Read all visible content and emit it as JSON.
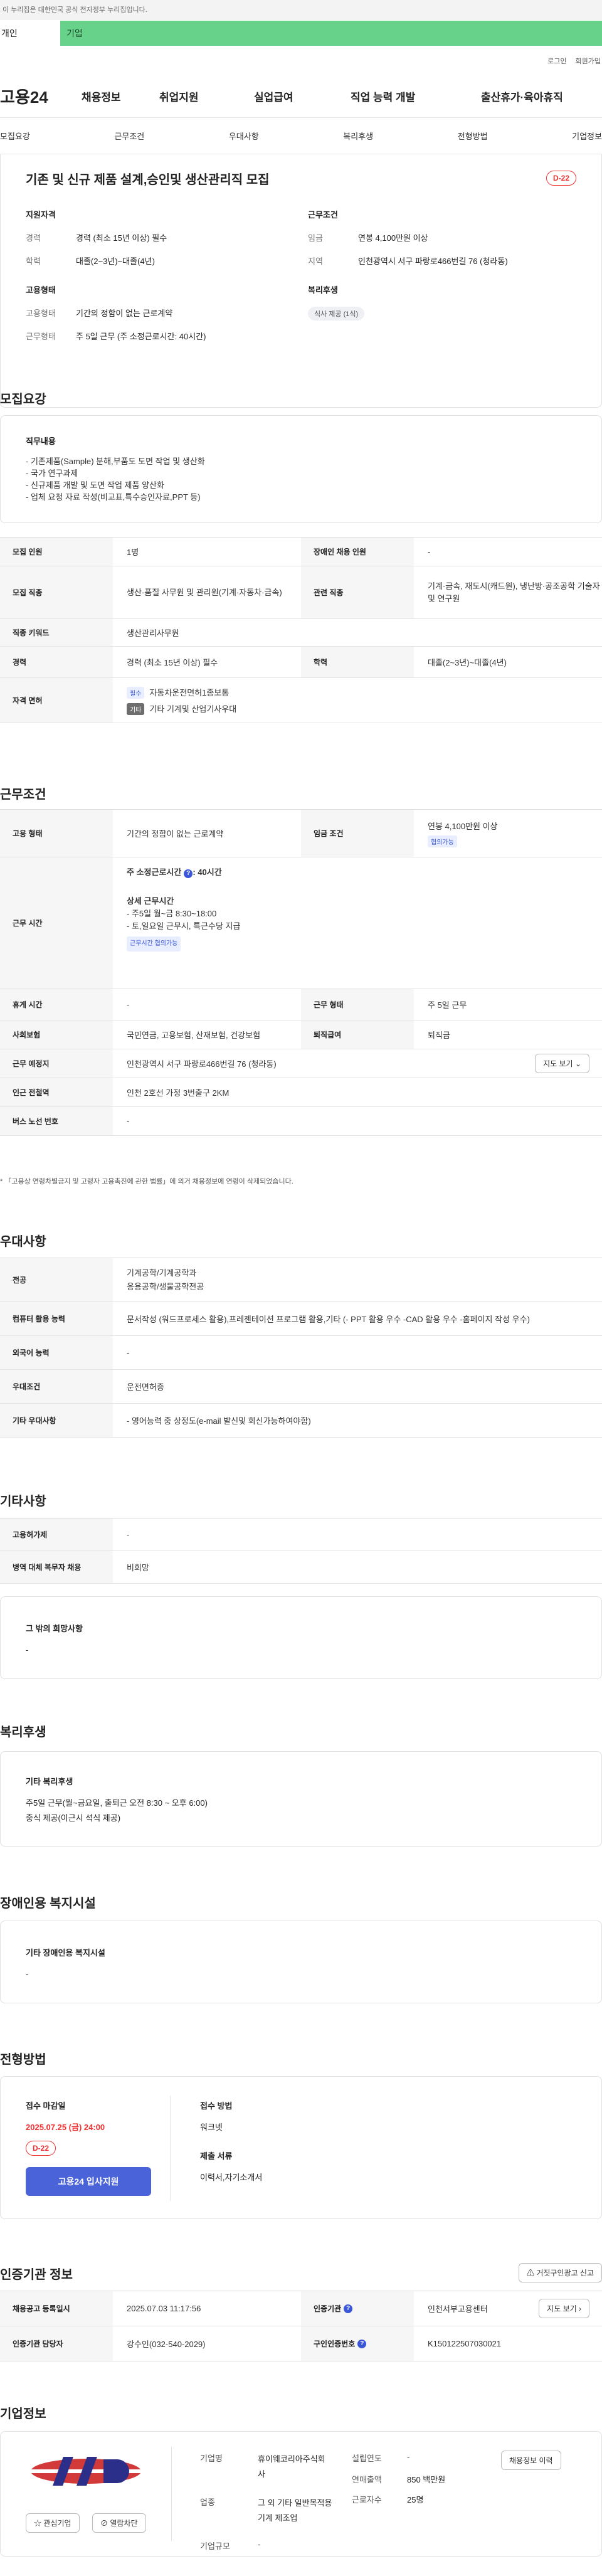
{
  "header": {
    "gov_banner": "이 누리집은 대한민국 공식 전자정부 누리집입니다.",
    "tab_personal": "개인",
    "tab_corporate": "기업",
    "login": "로그인",
    "join": "회원가입",
    "logo": "고용24",
    "gnb": [
      "채용정보",
      "취업지원",
      "실업급여",
      "직업 능력 개발",
      "출산휴가·육아휴직"
    ]
  },
  "subnav": [
    "모집요강",
    "근무조건",
    "우대사항",
    "복리후생",
    "전형방법",
    "기업정보"
  ],
  "summary": {
    "title": "기존 및 신규 제품 설계,승인및 생산관리직 모집",
    "dday": "D-22",
    "qual_heading": "지원자격",
    "qual_items": [
      {
        "k": "경력",
        "v": "경력 (최소 15년 이상) 필수"
      },
      {
        "k": "학력",
        "v": "대졸(2~3년)~대졸(4년)"
      }
    ],
    "cond_heading": "근무조건",
    "cond_items": [
      {
        "k": "임금",
        "v": "연봉 4,100만원 이상"
      },
      {
        "k": "지역",
        "v": "인천광역시 서구 파랑로466번길 76 (청라동)"
      }
    ],
    "emp_heading": "고용형태",
    "emp_items": [
      {
        "k": "고용형태",
        "v": "기간의 정함이 없는 근로계약"
      },
      {
        "k": "근무형태",
        "v": "주 5일 근무 (주 소정근로시간: 40시간)"
      }
    ],
    "welfare_heading": "복리후생",
    "welfare_chip": "식사 제공 (1식)"
  },
  "recruit": {
    "title": "모집요강",
    "duty_heading": "직무내용",
    "duty_lines": [
      "- 기존제품(Sample) 분해,부품도 도면 작업 및 생산화",
      "- 국가 연구과제",
      "- 신규제품 개발 및 도면 작업 제품 양산화",
      "- 업체 요청 자료 작성(비교표,특수승인자료,PPT 등)"
    ],
    "rows": {
      "headcount_label": "모집 인원",
      "headcount": "1명",
      "disabled_label": "장애인 채용 인원",
      "disabled": "-",
      "job_label": "모집 직종",
      "job": "생산·품질 사무원 및 관리원(기계·자동차·금속)",
      "related_label": "관련 직종",
      "related": "기계·금속, 재도시(캐드원), 냉난방·공조공학 기술자 및 연구원",
      "keyword_label": "직종 키워드",
      "keyword": "생산관리사무원",
      "career_label": "경력",
      "career": "경력 (최소 15년 이상) 필수",
      "edu_label": "학력",
      "edu": "대졸(2~3년)~대졸(4년)",
      "license_label": "자격 면허",
      "license1_badge": "필수",
      "license1": "자동차운전면허1종보통",
      "license2_badge": "기타",
      "license2": "기타 기계및 산업기사우대"
    }
  },
  "work": {
    "title": "근무조건",
    "emp_label": "고용 형태",
    "emp": "기간의 정함이 없는 근로계약",
    "wage_label": "임금 조건",
    "wage": "연봉 4,100만원 이상",
    "wage_badge": "협의가능",
    "hours_label": "근무 시간",
    "weekly_hours": "주 소정근로시간",
    "weekly_hours_value": ": 40시간",
    "detail_heading": "상세 근무시간",
    "detail_lines": [
      "- 주5일 월~금 8:30~18:00",
      "- 토,일요일 근무시, 특근수당 지급"
    ],
    "hours_badge": "근무시간 협의가능",
    "holiday_label": "휴게 시간",
    "holiday": "-",
    "workshape_label": "근무 형태",
    "workshape": "주 5일 근무",
    "insurance_label": "사회보험",
    "insurance": "국민연금, 고용보험, 산재보험, 건강보험",
    "retire_label": "퇴직급여",
    "retire": "퇴직금",
    "place_label": "근무 예정지",
    "place": "인천광역시 서구 파랑로466번길 76 (청라동)",
    "map_btn": "지도 보기",
    "station_label": "인근 전철역",
    "station": "인천 2호선 가정 3번출구 2KM",
    "bus_label": "버스 노선 번호",
    "bus": "-",
    "note": "* 「고용상 연령차별금지 및 고령자 고용촉진에 관한 법률」에 의거 채용정보에 연령이 삭제되었습니다."
  },
  "pref": {
    "title": "우대사항",
    "major_label": "전공",
    "major1": "기계공학/기계공학과",
    "major2": "응용공학/생물공학전공",
    "computer_label": "컴퓨터 활용 능력",
    "computer": "문서작성 (워드프로세스 활용),프레젠테이션 프로그램 활용,기타 (- PPT 활용 우수 -CAD 활용 우수 -홈페이지 작성 우수)",
    "foreign_label": "외국어 능력",
    "foreign": "-",
    "cond_label": "우대조건",
    "cond": "운전면허증",
    "etc_label": "기타 우대사항",
    "etc": "- 영어능력 중 상정도(e-mail 발신및 회신가능하여야함)"
  },
  "other": {
    "title": "기타사항",
    "insurance_label": "고용허가제",
    "insurance": "-",
    "military_label": "병역 대체 복무자 채용",
    "military": "비희망",
    "hope_heading": "그 밖의 희망사항",
    "hope": "-"
  },
  "welfare": {
    "title": "복리후생",
    "heading": "기타 복리후생",
    "line1": "주5일 근무(월~금요일, 출퇴근 오전 8:30 ~ 오후 6:00)",
    "line2": "중식 제공(이근시 석식 제공)"
  },
  "facility": {
    "title": "장애인용 복지시설",
    "heading": "기타 장애인용 복지시설",
    "value": "-"
  },
  "process": {
    "title": "전형방법",
    "deadline_label": "접수 마감일",
    "deadline": "2025.07.25 (금) 24:00",
    "dday": "D-22",
    "apply_btn": "고용24 입사지원",
    "method_label": "접수 방법",
    "method": "워크넷",
    "docs_label": "제출 서류",
    "docs": "이력서,자기소개서"
  },
  "cert": {
    "title": "인증기관 정보",
    "report_btn": "거짓구인광고 신고",
    "reg_label": "채용공고 등록일시",
    "reg": "2025.07.03 11:17:56",
    "agency_label": "인증기관",
    "agency": "인천서부고용센터",
    "map_btn": "지도 보기",
    "manager_label": "인증기관 담당자",
    "manager": "강수인(032-540-2029)",
    "num_label": "구인인증번호",
    "num": "K150122507030021"
  },
  "company": {
    "title": "기업정보",
    "fav_btn": "관심기업",
    "block_btn": "열람차단",
    "name_label": "기업명",
    "name": "휴이웨코리아주식회사",
    "industry_label": "업종",
    "industry": "그 외 기타 일반목적용 기계 제조업",
    "size_label": "기업규모",
    "size": "-",
    "founded_label": "설립연도",
    "founded": "-",
    "sales_label": "연매출액",
    "sales": "850 백만원",
    "employees_label": "근로자수",
    "employees": "25명",
    "list_btn": "채용정보 이력"
  },
  "colors": {
    "accent": "#4a63d8",
    "green_tab": "#67d28a",
    "dday": "#e33333"
  }
}
